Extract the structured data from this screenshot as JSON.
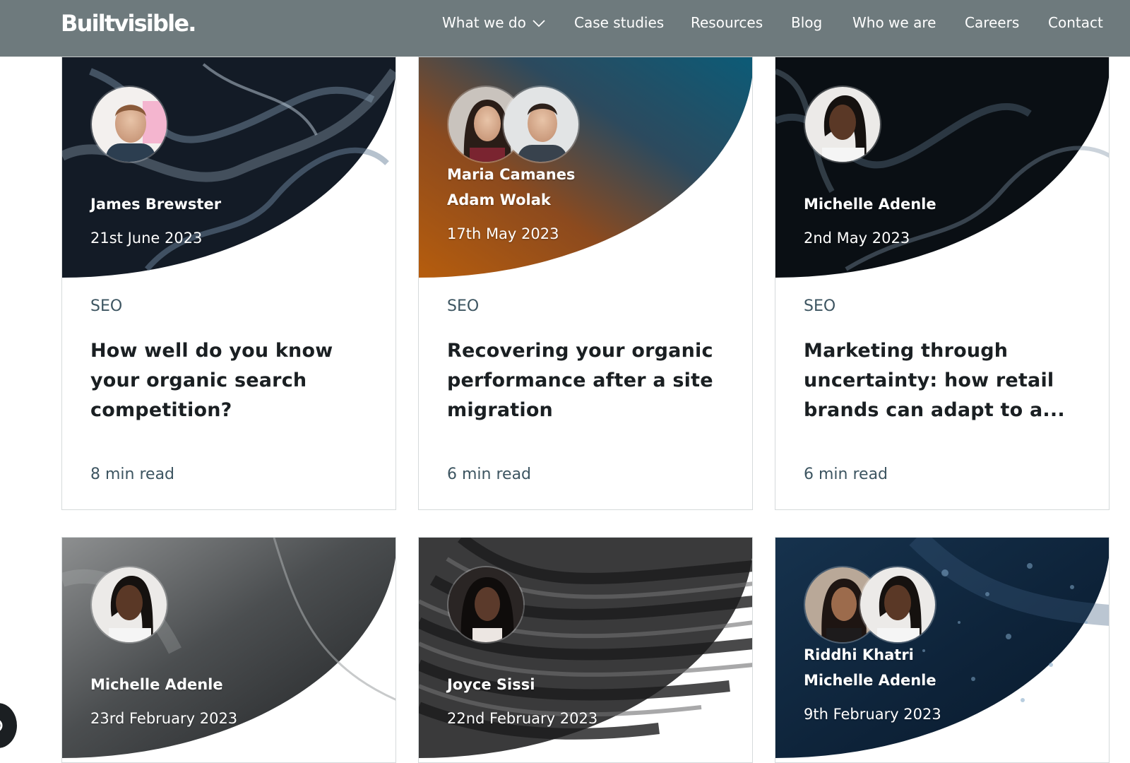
{
  "brand": {
    "logo": "Builtvisible."
  },
  "nav": {
    "items": [
      {
        "label": "What we do",
        "dropdown": true
      },
      {
        "label": "Case studies"
      },
      {
        "label": "Resources"
      },
      {
        "label": "Blog"
      },
      {
        "label": "Who we are"
      },
      {
        "label": "Careers"
      },
      {
        "label": "Contact"
      }
    ]
  },
  "articles": [
    {
      "authors": [
        "James Brewster"
      ],
      "date": "21st June 2023",
      "category": "SEO",
      "title": "How well do you know your organic search competition?",
      "read_time": "8 min read",
      "theme": "smoke-dark"
    },
    {
      "authors": [
        "Maria Camanes",
        "Adam Wolak"
      ],
      "date": "17th May 2023",
      "category": "SEO",
      "title": "Recovering your organic performance after a site migration",
      "read_time": "6 min read",
      "theme": "gradient-teal-orange"
    },
    {
      "authors": [
        "Michelle Adenle"
      ],
      "date": "2nd May 2023",
      "category": "SEO",
      "title": "Marketing through uncertainty: how retail brands can adapt to a...",
      "read_time": "6 min read",
      "theme": "smoke-black"
    },
    {
      "authors": [
        "Michelle Adenle"
      ],
      "date": "23rd February 2023",
      "category": "",
      "title": "",
      "read_time": "",
      "theme": "grey-fabric"
    },
    {
      "authors": [
        "Joyce Sissi"
      ],
      "date": "22nd February 2023",
      "category": "",
      "title": "",
      "read_time": "",
      "theme": "sand-ridges"
    },
    {
      "authors": [
        "Riddhi Khatri",
        "Michelle Adenle"
      ],
      "date": "9th February 2023",
      "category": "",
      "title": "",
      "read_time": "",
      "theme": "navy-bubbles"
    }
  ],
  "colors": {
    "header_bg": "#6e7a7d",
    "meta_text": "#3d5561",
    "title_text": "#1a1f22",
    "card_border": "#d6dadb"
  },
  "icons": {
    "chat": "chat-icon",
    "dropdown": "chevron-down-icon"
  }
}
